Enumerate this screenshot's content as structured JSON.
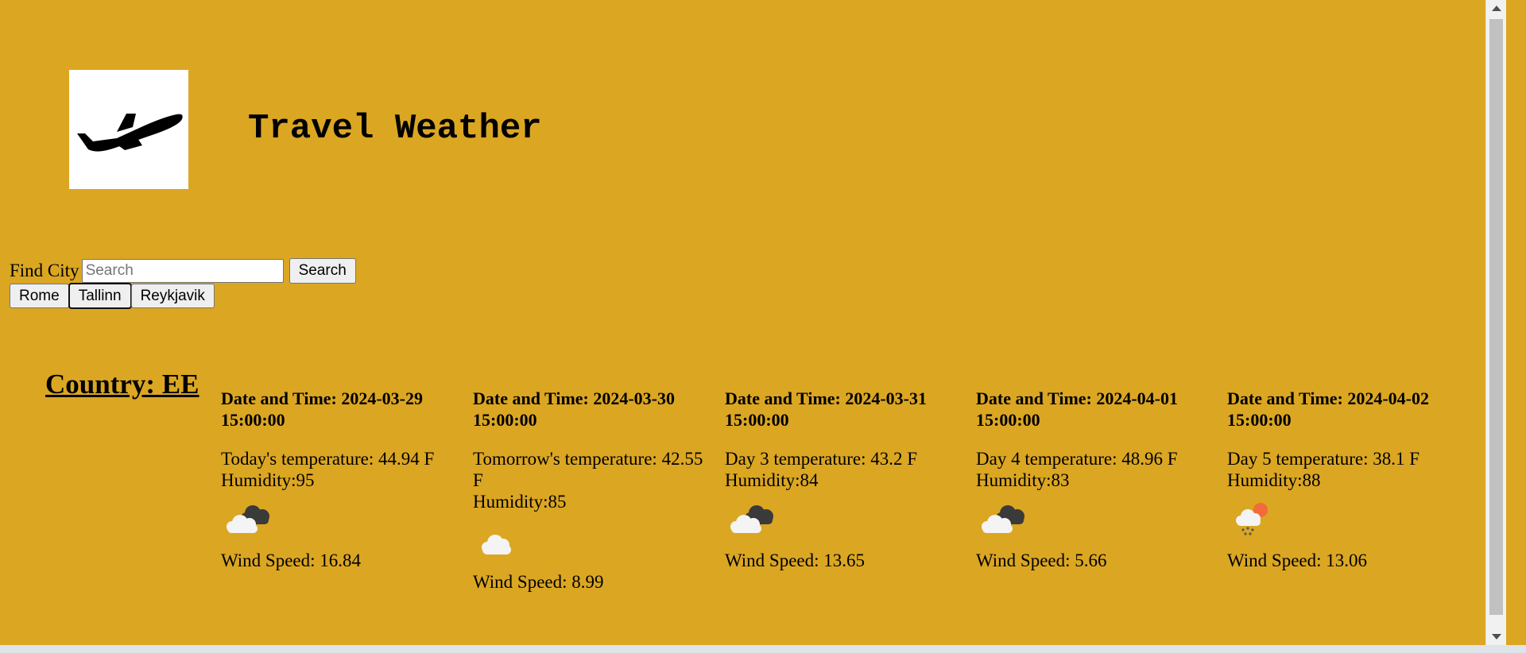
{
  "header": {
    "title": "Travel Weather",
    "logo_icon": "airplane-takeoff-icon"
  },
  "search": {
    "label": "Find City",
    "placeholder": "Search",
    "value": "",
    "button_label": "Search"
  },
  "recent_cities": [
    {
      "label": "Rome"
    },
    {
      "label": "Tallinn",
      "focused": true
    },
    {
      "label": "Reykjavik"
    }
  ],
  "country": {
    "text": "Country: EE"
  },
  "forecast": [
    {
      "datetime": "Date and Time: 2024-03-29 15:00:00",
      "temperature": "Today's temperature: 44.94 F",
      "humidity": "Humidity:95",
      "icon": "broken-clouds-icon",
      "wind": "Wind Speed: 16.84"
    },
    {
      "datetime": "Date and Time: 2024-03-30 15:00:00",
      "temperature": "Tomorrow's temperature: 42.55 F",
      "humidity": "Humidity:85",
      "icon": "cloud-icon",
      "wind": "Wind Speed: 8.99"
    },
    {
      "datetime": "Date and Time: 2024-03-31 15:00:00",
      "temperature": "Day 3 temperature: 43.2 F",
      "humidity": "Humidity:84",
      "icon": "broken-clouds-icon",
      "wind": "Wind Speed: 13.65"
    },
    {
      "datetime": "Date and Time: 2024-04-01 15:00:00",
      "temperature": "Day 4 temperature: 48.96 F",
      "humidity": "Humidity:83",
      "icon": "broken-clouds-icon",
      "wind": "Wind Speed: 5.66"
    },
    {
      "datetime": "Date and Time: 2024-04-02 15:00:00",
      "temperature": "Day 5 temperature: 38.1 F",
      "humidity": "Humidity:88",
      "icon": "sun-snow-icon",
      "wind": "Wind Speed: 13.06"
    }
  ],
  "colors": {
    "background": "#dba622",
    "logo_background": "#ffffff"
  }
}
